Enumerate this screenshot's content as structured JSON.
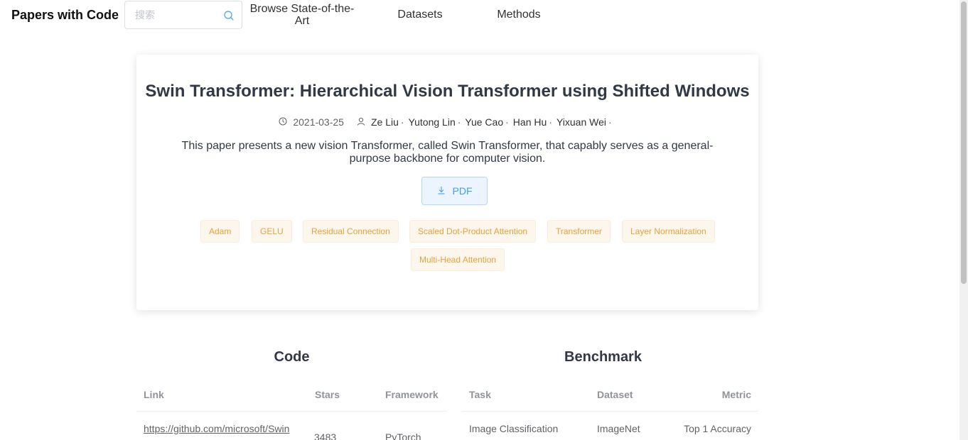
{
  "header": {
    "brand": "Papers with Code",
    "search_placeholder": "搜索",
    "nav": {
      "browse": "Browse State-of-the-Art",
      "datasets": "Datasets",
      "methods": "Methods"
    }
  },
  "paper": {
    "title": "Swin Transformer: Hierarchical Vision Transformer using Shifted Windows",
    "date": "2021-03-25",
    "authors": [
      "Ze Liu",
      "Yutong Lin",
      "Yue Cao",
      "Han Hu",
      "Yixuan Wei"
    ],
    "author_separator": "·",
    "abstract": "This paper presents a new vision Transformer, called Swin Transformer, that capably serves as a general-purpose backbone for computer vision.",
    "pdf_label": "PDF",
    "tags": [
      "Adam",
      "GELU",
      "Residual Connection",
      "Scaled Dot-Product Attention",
      "Transformer",
      "Layer Normalization",
      "Multi-Head Attention"
    ]
  },
  "code": {
    "title": "Code",
    "headers": {
      "link": "Link",
      "stars": "Stars",
      "framework": "Framework"
    },
    "rows": [
      {
        "link": "https://github.com/microsoft/Swin",
        "stars": "3483",
        "framework": "PyTorch"
      }
    ]
  },
  "benchmark": {
    "title": "Benchmark",
    "headers": {
      "task": "Task",
      "dataset": "Dataset",
      "metric": "Metric"
    },
    "rows": [
      {
        "task": "Image Classification",
        "dataset": "ImageNet",
        "metric": "Top 1 Accuracy"
      }
    ]
  },
  "colors": {
    "tag_text": "#e6a23c",
    "tag_bg": "#fdf6ec",
    "primary": "#409eff"
  },
  "icons": {
    "search": "search-icon",
    "date": "clock-icon",
    "author": "user-icon",
    "pdf": "download-icon"
  }
}
